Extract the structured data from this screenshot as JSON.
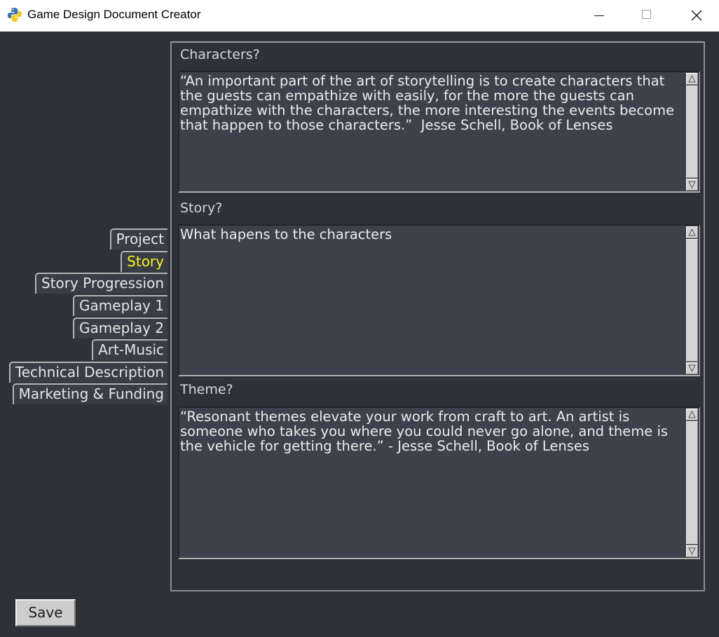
{
  "window": {
    "title": "Game Design Document Creator",
    "icon": "python-icon",
    "controls": [
      "minimize-icon",
      "maximize-icon",
      "close-icon"
    ]
  },
  "tabs": [
    {
      "label": "Project",
      "active": false
    },
    {
      "label": "Story",
      "active": true
    },
    {
      "label": "Story Progression",
      "active": false
    },
    {
      "label": "Gameplay 1",
      "active": false
    },
    {
      "label": "Gameplay 2",
      "active": false
    },
    {
      "label": "Art-Music",
      "active": false
    },
    {
      "label": "Technical Description",
      "active": false
    },
    {
      "label": "Marketing & Funding",
      "active": false
    }
  ],
  "sections": {
    "characters": {
      "label": "Characters?",
      "text": "“An important part of the art of storytelling is to create characters that the guests can empathize with easily, for the more the guests can empathize with the characters, the more interesting the events become that happen to those characters.”  Jesse Schell, Book of Lenses"
    },
    "story": {
      "label": "Story?",
      "text": "What hapens to the characters"
    },
    "theme": {
      "label": "Theme?",
      "text": "“Resonant themes elevate your work from craft to art. An artist is someone who takes you where you could never go alone, and theme is the vehicle for getting there.” - Jesse Schell, Book of Lenses"
    }
  },
  "save_label": "Save",
  "colors": {
    "background": "#2e3138",
    "textbox": "#3e414b",
    "active_tab": "#f7f41d",
    "text": "#ececec"
  }
}
